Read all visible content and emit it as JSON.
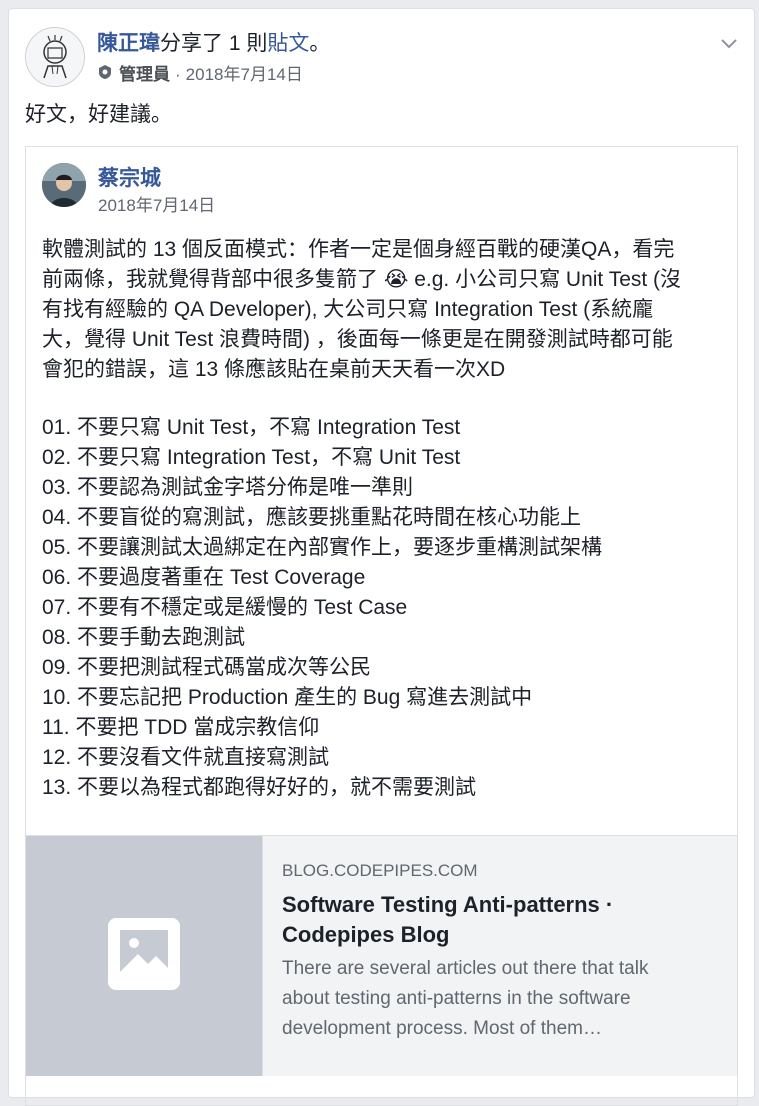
{
  "post": {
    "author": "陳正瑋",
    "action_text": "分享了 1 則",
    "post_link": "貼文",
    "action_suffix": "。",
    "role": "管理員",
    "separator": "·",
    "date": "2018年7月14日",
    "text": "好文，好建議。"
  },
  "shared_post": {
    "author": "蔡宗城",
    "date": "2018年7月14日",
    "body": [
      "軟體測試的 13 個反面模式：作者一定是個身經百戰的硬漢QA，看完",
      "前兩條，我就覺得背部中很多隻箭了 😭 e.g. 小公司只寫 Unit Test (沒",
      "有找有經驗的 QA Developer), 大公司只寫 Integration Test (系統龐",
      "大，覺得 Unit Test 浪費時間) ，後面每一條更是在開發測試時都可能",
      "會犯的錯誤，這 13 條應該貼在桌前天天看一次XD"
    ],
    "list": [
      "01. 不要只寫 Unit Test，不寫 Integration Test",
      "02. 不要只寫 Integration Test，不寫 Unit Test",
      "03. 不要認為測試金字塔分佈是唯一準則",
      "04. 不要盲從的寫測試，應該要挑重點花時間在核心功能上",
      "05. 不要讓測試太過綁定在內部實作上，要逐步重構測試架構",
      "06. 不要過度著重在 Test Coverage",
      "07. 不要有不穩定或是緩慢的 Test Case",
      "08. 不要手動去跑測試",
      "09. 不要把測試程式碼當成次等公民",
      "10. 不要忘記把 Production 產生的 Bug 寫進去測試中",
      "11. 不要把 TDD 當成宗教信仰",
      "12. 不要沒看文件就直接寫測試",
      "13. 不要以為程式都跑得好好的，就不需要測試"
    ]
  },
  "link_preview": {
    "domain": "BLOG.CODEPIPES.COM",
    "title_line1": "Software Testing Anti-patterns ·",
    "title_line2": "Codepipes Blog",
    "desc_line1": "There are several articles out there that talk",
    "desc_line2": "about testing anti-patterns in the software",
    "desc_line3": "development process. Most of them…",
    "thumbnail_icon": "image-placeholder-icon"
  },
  "colors": {
    "link": "#365899",
    "meta": "#606770",
    "background": "#e9ebee"
  }
}
